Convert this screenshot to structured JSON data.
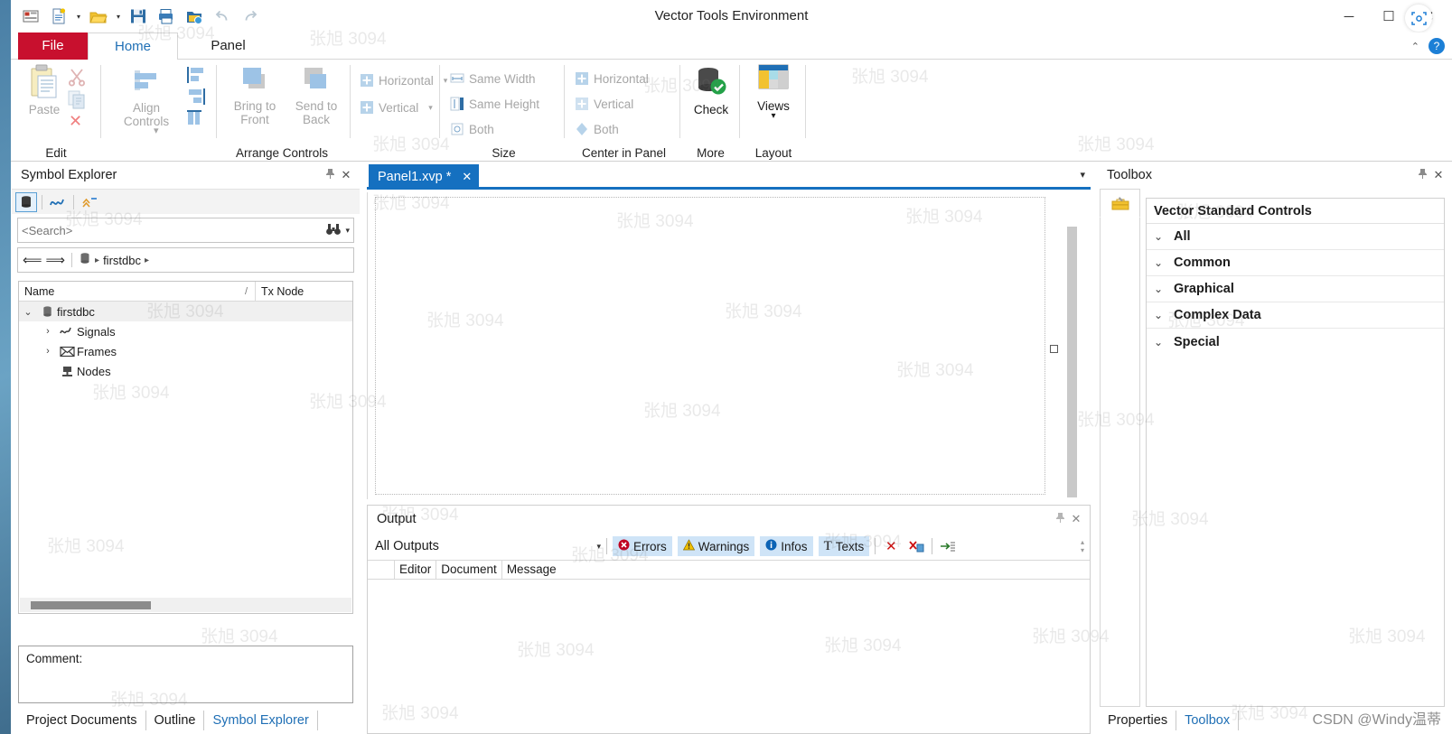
{
  "window": {
    "title": "Vector Tools Environment",
    "minimize": "─",
    "maximize": "☐",
    "close": "✕"
  },
  "quick_access": {
    "items": [
      {
        "name": "new-panel-icon",
        "glyph": "▤"
      },
      {
        "name": "new-document-icon",
        "glyph": "Ὄ4"
      },
      {
        "name": "open-folder-icon",
        "glyph": "Ὄ2"
      },
      {
        "name": "save-icon",
        "glyph": "Ὃe"
      },
      {
        "name": "print-icon",
        "glyph": "὚8"
      },
      {
        "name": "open-recent-icon",
        "glyph": "Ὄ1"
      },
      {
        "name": "undo-icon",
        "glyph": "↶"
      },
      {
        "name": "redo-icon",
        "glyph": "↷"
      }
    ]
  },
  "ribbon": {
    "tabs": [
      {
        "label": "File",
        "active": false
      },
      {
        "label": "Home",
        "active": true
      },
      {
        "label": "Panel",
        "active": false
      }
    ],
    "collapse_caret": "⌃",
    "help_label": "?",
    "groups": [
      {
        "name": "Edit",
        "buttons": [
          {
            "label": "Paste",
            "icon": "paste-icon",
            "disabled": true
          },
          {
            "label": "Cut",
            "icon": "cut-icon",
            "disabled": true
          },
          {
            "label": "Copy",
            "icon": "copy-icon",
            "disabled": true
          },
          {
            "label": "Delete",
            "icon": "delete-icon",
            "disabled": true
          }
        ]
      },
      {
        "name": "Arrange Controls",
        "buttons": [
          {
            "label": "Align Controls",
            "icon": "align-controls-icon",
            "disabled": true
          },
          {
            "label": "Bring to Front",
            "icon": "bring-to-front-icon",
            "disabled": true
          },
          {
            "label": "Send to Back",
            "icon": "send-to-back-icon",
            "disabled": true
          }
        ],
        "distribute": [
          {
            "label": "Horizontal",
            "icon": "distribute-horizontal-icon",
            "disabled": true,
            "has_caret": true
          },
          {
            "label": "Vertical",
            "icon": "distribute-vertical-icon",
            "disabled": true,
            "has_caret": true
          }
        ]
      },
      {
        "name": "Size",
        "items": [
          {
            "label": "Same Width",
            "icon": "same-width-icon",
            "disabled": true
          },
          {
            "label": "Same Height",
            "icon": "same-height-icon",
            "disabled": true
          },
          {
            "label": "Both",
            "icon": "same-both-icon",
            "disabled": true
          }
        ]
      },
      {
        "name": "Center in Panel",
        "items": [
          {
            "label": "Horizontal",
            "icon": "center-horizontal-icon",
            "disabled": true
          },
          {
            "label": "Vertical",
            "icon": "center-vertical-icon",
            "disabled": true
          },
          {
            "label": "Both",
            "icon": "center-both-icon",
            "disabled": true
          }
        ]
      },
      {
        "name": "More",
        "buttons": [
          {
            "label": "Check",
            "icon": "check-database-icon",
            "disabled": false
          }
        ]
      },
      {
        "name": "Layout",
        "buttons": [
          {
            "label": "Views",
            "icon": "views-icon",
            "disabled": false,
            "has_caret": true
          }
        ]
      }
    ]
  },
  "symbol_explorer": {
    "title": "Symbol Explorer",
    "pin": "⚓",
    "close": "✕",
    "toolbar": [
      {
        "name": "database-filter-icon",
        "selected": true
      },
      {
        "name": "signal-wave-icon",
        "selected": false
      },
      {
        "name": "expand-collapse-icon",
        "selected": false
      }
    ],
    "search": {
      "placeholder": "<Search>",
      "value": "",
      "icon": "binoculars-icon",
      "caret": "▾"
    },
    "breadcrumb": {
      "back": "⟸",
      "forward": "⟹",
      "root_icon": "database-icon",
      "items": [
        "firstdbc"
      ],
      "sep": "▸"
    },
    "tree": {
      "columns": [
        "Name",
        "Tx Node"
      ],
      "sort_indicator": "/",
      "rows": [
        {
          "label": "firstdbc",
          "icon": "database-icon",
          "level": 0,
          "expander": "⌄",
          "selected": true
        },
        {
          "label": "Signals",
          "icon": "signal-wave-icon",
          "level": 1,
          "expander": "›",
          "selected": false
        },
        {
          "label": "Frames",
          "icon": "frame-envelope-icon",
          "level": 1,
          "expander": "›",
          "selected": false
        },
        {
          "label": "Nodes",
          "icon": "node-icon",
          "level": 1,
          "expander": "",
          "selected": false
        }
      ]
    },
    "comment": {
      "label": "Comment:",
      "value": ""
    },
    "dock_tabs": [
      {
        "label": "Project Documents",
        "active": false
      },
      {
        "label": "Outline",
        "active": false
      },
      {
        "label": "Symbol Explorer",
        "active": true
      }
    ]
  },
  "document": {
    "tabs": [
      {
        "label": "Panel1.xvp *",
        "close": "✕",
        "active": true
      }
    ],
    "tab_list_caret": "▾",
    "canvas": {
      "resize_handle": "design-resize-handle"
    }
  },
  "output": {
    "title": "Output",
    "pin": "⚓",
    "close": "✕",
    "filter": {
      "selected": "All Outputs",
      "caret": "▾"
    },
    "filter_buttons": [
      {
        "label": "Errors",
        "icon": "error-icon",
        "color": "#c00020",
        "active": true
      },
      {
        "label": "Warnings",
        "icon": "warning-icon",
        "color": "#e8b100",
        "active": true
      },
      {
        "label": "Infos",
        "icon": "info-icon",
        "color": "#0b63b5",
        "active": true
      },
      {
        "label": "Texts",
        "icon": "text-icon",
        "color": "#333333",
        "active": true
      }
    ],
    "action_buttons": [
      {
        "name": "clear-output-button",
        "glyph": "✕",
        "color": "#cc1111"
      },
      {
        "name": "clear-filtered-output-button",
        "glyph": "✕",
        "color": "#cc1111"
      },
      {
        "name": "autoscroll-button",
        "glyph": "→",
        "color": "#333333"
      }
    ],
    "scroll_up": "▴",
    "scroll_down": "▾",
    "columns": [
      "Editor",
      "Document",
      "Message"
    ],
    "rows": []
  },
  "toolbox": {
    "title": "Toolbox",
    "pin": "⚓",
    "close": "✕",
    "tab_icon": "toolbox-icon",
    "list_title": "Vector Standard Controls",
    "groups": [
      {
        "label": "All",
        "expander": "⌄"
      },
      {
        "label": "Common",
        "expander": "⌄"
      },
      {
        "label": "Graphical",
        "expander": "⌄"
      },
      {
        "label": "Complex Data",
        "expander": "⌄"
      },
      {
        "label": "Special",
        "expander": "⌄"
      }
    ],
    "dock_tabs": [
      {
        "label": "Properties",
        "active": false
      },
      {
        "label": "Toolbox",
        "active": true
      }
    ]
  },
  "watermark": {
    "text": "张旭 3094",
    "credit": "CSDN @Windy温蒂"
  },
  "colors": {
    "accent_blue": "#1570c0",
    "file_red": "#c8102e",
    "link_blue": "#1f6fb5",
    "filter_bg": "#cfe4f7"
  }
}
